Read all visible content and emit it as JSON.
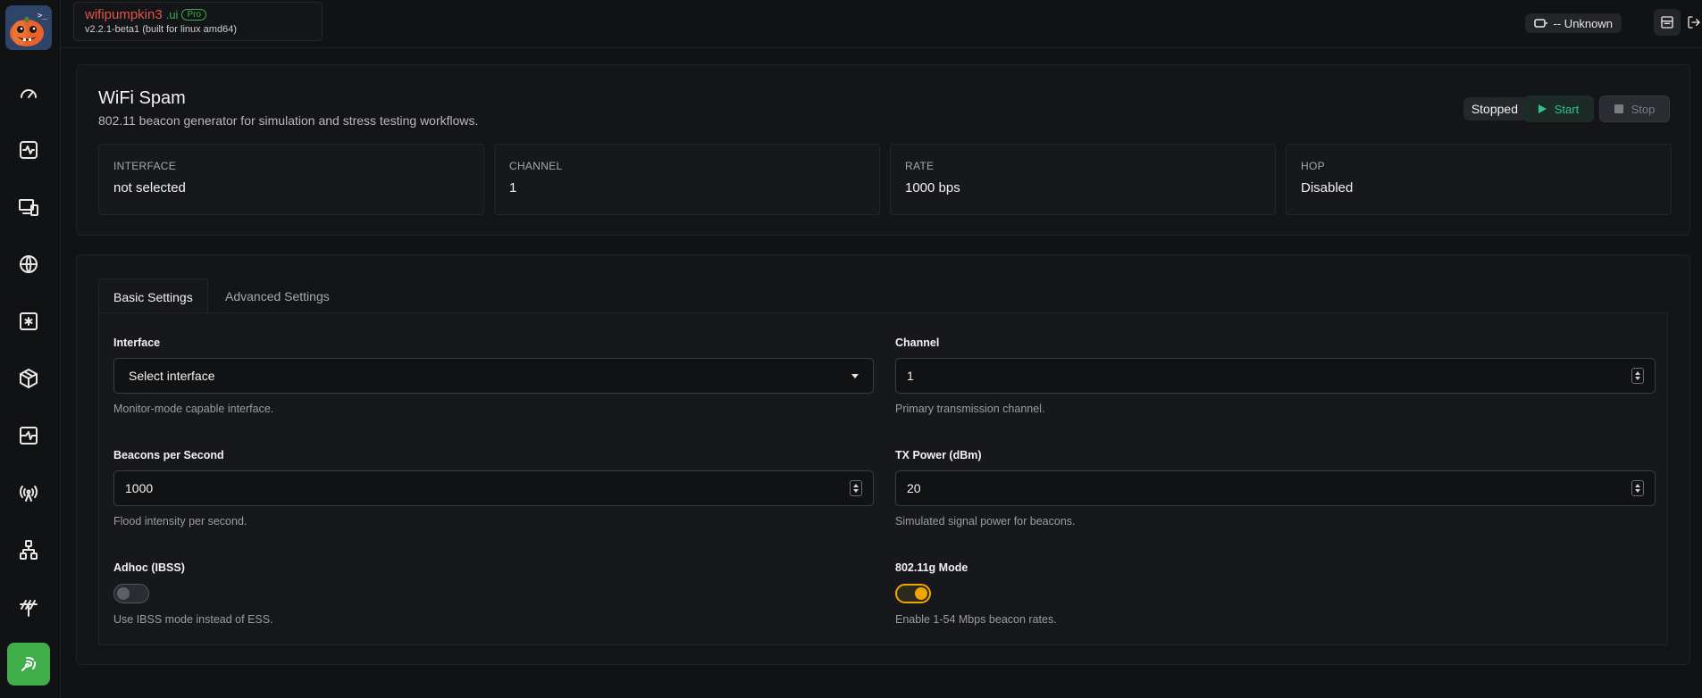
{
  "brand": {
    "name": "wifipumpkin3",
    "suffix": ".ui",
    "badge": "Pro",
    "version": "v2.2.1-beta1 (built for linux amd64)"
  },
  "header": {
    "connection_status": "-- Unknown"
  },
  "sidebar": {
    "items": [
      {
        "icon": "gauge-icon"
      },
      {
        "icon": "activity-icon"
      },
      {
        "icon": "devices-icon"
      },
      {
        "icon": "globe-icon"
      },
      {
        "icon": "asterisk-square-icon"
      },
      {
        "icon": "package-icon"
      },
      {
        "icon": "server-icon"
      },
      {
        "icon": "radio-tower-icon"
      },
      {
        "icon": "network-icon"
      },
      {
        "icon": "antenna-icon"
      },
      {
        "icon": "wifi-spam-icon",
        "active": true
      }
    ]
  },
  "page": {
    "title": "WiFi Spam",
    "subtitle": "802.11 beacon generator for simulation and stress testing workflows.",
    "status": "Stopped",
    "start_label": "Start",
    "stop_label": "Stop"
  },
  "stats": [
    {
      "label": "INTERFACE",
      "value": "not selected"
    },
    {
      "label": "CHANNEL",
      "value": "1"
    },
    {
      "label": "RATE",
      "value": "1000 bps"
    },
    {
      "label": "HOP",
      "value": "Disabled"
    }
  ],
  "tabs": [
    {
      "label": "Basic Settings",
      "active": true
    },
    {
      "label": "Advanced Settings",
      "active": false
    }
  ],
  "form": {
    "interface": {
      "label": "Interface",
      "value": "Select interface",
      "help": "Monitor-mode capable interface."
    },
    "channel": {
      "label": "Channel",
      "value": "1",
      "help": "Primary transmission channel."
    },
    "beacons": {
      "label": "Beacons per Second",
      "value": "1000",
      "help": "Flood intensity per second."
    },
    "tx_power": {
      "label": "TX Power (dBm)",
      "value": "20",
      "help": "Simulated signal power for beacons."
    },
    "adhoc": {
      "label": "Adhoc (IBSS)",
      "enabled": false,
      "help": "Use IBSS mode instead of ESS."
    },
    "mode_80211g": {
      "label": "802.11g Mode",
      "enabled": true,
      "help": "Enable 1-54 Mbps beacon rates."
    }
  },
  "colors": {
    "accent_green": "#3fae4a",
    "start_teal": "#2fc28f",
    "toggle_on": "#f0a500",
    "brand_red": "#e5534b"
  }
}
